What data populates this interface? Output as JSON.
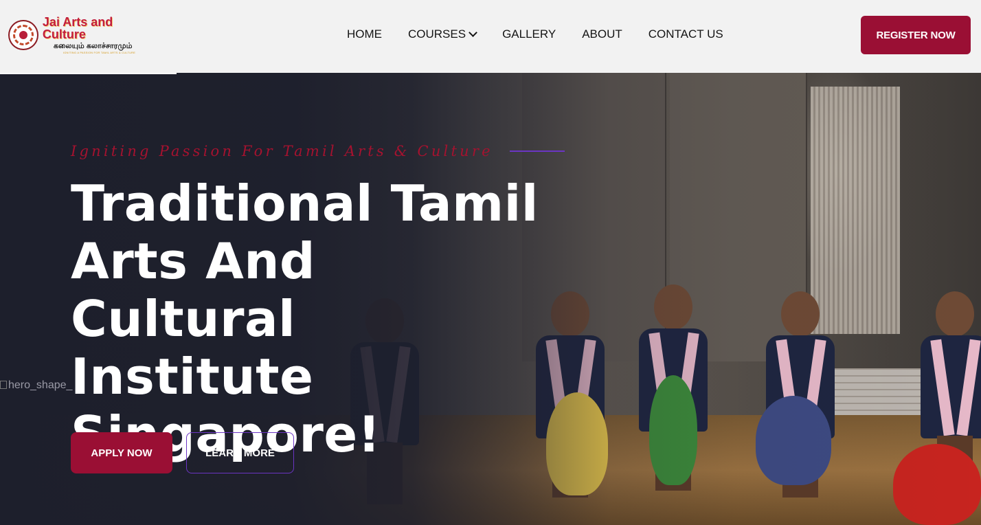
{
  "header": {
    "logo": {
      "name": "Jai Arts and Culture",
      "tamil": "கலையும் கலாச்சாரமும்",
      "tagline": "IGNITING A PASSION FOR TAMIL ARTS & CULTURE"
    },
    "nav": [
      {
        "label": "HOME"
      },
      {
        "label": "COURSES",
        "has_dropdown": true
      },
      {
        "label": "GALLERY"
      },
      {
        "label": "ABOUT"
      },
      {
        "label": "CONTACT US"
      }
    ],
    "register_label": "REGISTER NOW"
  },
  "hero": {
    "image_alt": "hero_shape_",
    "tagline": "Igniting Passion For Tamil Arts & Culture",
    "title_lines": [
      "Traditional Tamil",
      "Arts And Cultural",
      "Institute",
      "Singapore!"
    ],
    "apply_label": "APPLY NOW",
    "learn_label": "LEARN MORE"
  },
  "colors": {
    "brand": "#9a0f34",
    "accent_purple": "#6b35c4",
    "hero_bg": "#1d1f2c",
    "header_bg": "#f2f2f2"
  }
}
